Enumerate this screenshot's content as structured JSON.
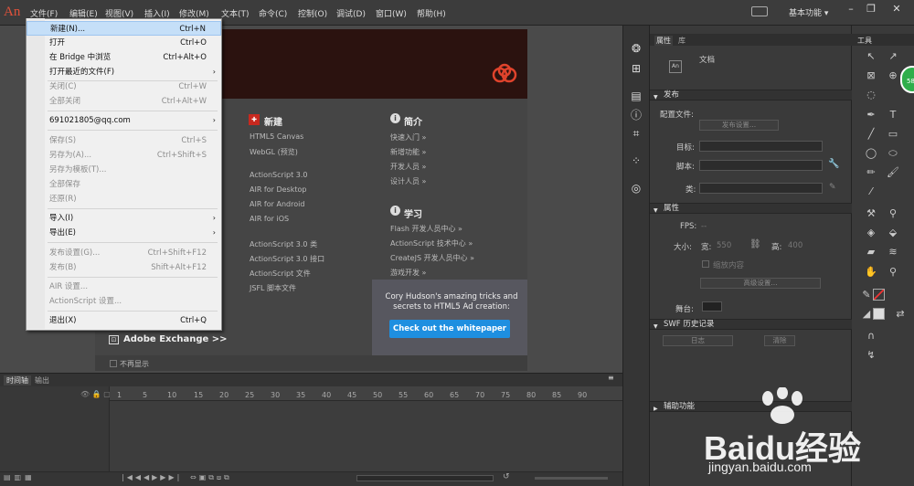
{
  "app": {
    "logo": "An"
  },
  "menubar": {
    "items": [
      "文件(F)",
      "编辑(E)",
      "视图(V)",
      "插入(I)",
      "修改(M)",
      "文本(T)",
      "命令(C)",
      "控制(O)",
      "调试(D)",
      "窗口(W)",
      "帮助(H)"
    ],
    "workspace": "基本功能",
    "workspace_arrow": "▾",
    "minimize": "–",
    "maximize": "❐",
    "close": "✕"
  },
  "file_menu": {
    "items": [
      {
        "label": "新建(N)...",
        "shortcut": "Ctrl+N",
        "disabled": false,
        "highlighted": true
      },
      {
        "label": "打开",
        "shortcut": "Ctrl+O",
        "disabled": false
      },
      {
        "label": "在 Bridge 中浏览",
        "shortcut": "Ctrl+Alt+O",
        "disabled": false
      },
      {
        "label": "打开最近的文件(F)",
        "shortcut": "",
        "arrow": "›",
        "disabled": false
      },
      {
        "label": "关闭(C)",
        "shortcut": "Ctrl+W",
        "disabled": true
      },
      {
        "label": "全部关闭",
        "shortcut": "Ctrl+Alt+W",
        "disabled": true
      },
      {
        "label": "691021805@qq.com",
        "shortcut": "",
        "arrow": "›",
        "disabled": false
      },
      {
        "label": "保存(S)",
        "shortcut": "Ctrl+S",
        "disabled": true
      },
      {
        "label": "另存为(A)...",
        "shortcut": "Ctrl+Shift+S",
        "disabled": true
      },
      {
        "label": "另存为模板(T)...",
        "shortcut": "",
        "disabled": true
      },
      {
        "label": "全部保存",
        "shortcut": "",
        "disabled": true
      },
      {
        "label": "还原(R)",
        "shortcut": "",
        "disabled": true
      },
      {
        "label": "导入(I)",
        "shortcut": "",
        "arrow": "›",
        "disabled": false
      },
      {
        "label": "导出(E)",
        "shortcut": "",
        "arrow": "›",
        "disabled": false
      },
      {
        "label": "发布设置(G)...",
        "shortcut": "Ctrl+Shift+F12",
        "disabled": true
      },
      {
        "label": "发布(B)",
        "shortcut": "Shift+Alt+F12",
        "disabled": true
      },
      {
        "label": "AIR 设置...",
        "shortcut": "",
        "disabled": true
      },
      {
        "label": "ActionScript 设置...",
        "shortcut": "",
        "disabled": true
      },
      {
        "label": "退出(X)",
        "shortcut": "Ctrl+Q",
        "disabled": false
      }
    ]
  },
  "welcome": {
    "new_heading": "新建",
    "new_items": [
      "HTML5 Canvas",
      "WebGL (预览)",
      "ActionScript 3.0",
      "AIR for Desktop",
      "AIR for Android",
      "AIR for iOS",
      "ActionScript 3.0 类",
      "ActionScript 3.0 接口",
      "ActionScript 文件",
      "JSFL 脚本文件"
    ],
    "intro_heading": "简介",
    "intro_items": [
      "快速入门 »",
      "新增功能 »",
      "开发人员 »",
      "设计人员 »"
    ],
    "learn_heading": "学习",
    "learn_items": [
      "Flash 开发人员中心 »",
      "ActionScript 技术中心 »",
      "CreateJS 开发人员中心 »",
      "游戏开发 »"
    ],
    "promo_text": "Cory Hudson's amazing tricks and secrets to HTML5 Ad creation:",
    "promo_button": "Check out the whitepaper",
    "exchange": "Adobe Exchange >>",
    "no_show": "不再显示"
  },
  "timeline": {
    "tab_timeline": "时间轴",
    "tab_output": "输出",
    "ruler": [
      "1",
      "5",
      "10",
      "15",
      "20",
      "25",
      "30",
      "35",
      "40",
      "45",
      "50",
      "55",
      "60",
      "65",
      "70",
      "75",
      "80",
      "85",
      "90"
    ]
  },
  "properties": {
    "tab_props": "属性",
    "tab_lib": "库",
    "doc_label": "文档",
    "doc_icon": "An",
    "publish_head": "发布",
    "profile_label": "配置文件:",
    "publish_settings_btn": "发布设置...",
    "target_label": "目标:",
    "script_label": "脚本:",
    "class_label": "类:",
    "props_head": "属性",
    "fps_label": "FPS:",
    "fps_value": "--",
    "size_label": "大小:",
    "width_label": "宽:",
    "width_value": "550",
    "height_label": "高:",
    "height_value": "400",
    "scale_label": "缩放内容",
    "advanced_btn": "高级设置...",
    "stage_label": "舞台:",
    "swf_head": "SWF 历史记录",
    "log_btn": "日志",
    "clear_btn": "清除",
    "helper_head": "辅助功能"
  },
  "tools": {
    "tab": "工具",
    "badge": "58"
  },
  "watermark": {
    "text": "Baidu经验",
    "url": "jingyan.baidu.com"
  }
}
